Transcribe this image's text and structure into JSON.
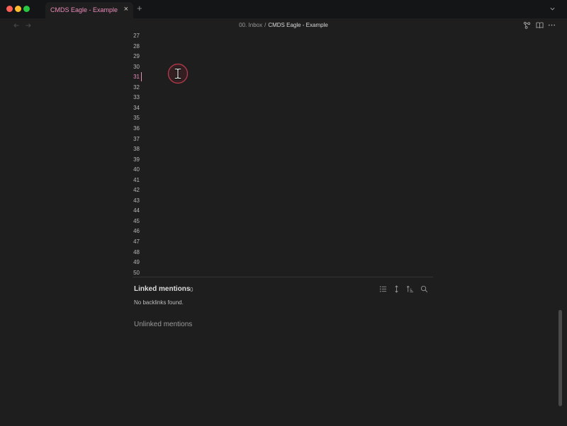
{
  "tab": {
    "title": "CMDS Eagle - Example",
    "close_glyph": "×",
    "new_tab_glyph": "+"
  },
  "breadcrumb": {
    "folder": "00. Inbox",
    "separator": "/",
    "current": "CMDS Eagle - Example"
  },
  "editor": {
    "line_numbers": [
      "27",
      "28",
      "29",
      "30",
      "31",
      "32",
      "33",
      "34",
      "35",
      "36",
      "37",
      "38",
      "39",
      "40",
      "41",
      "42",
      "43",
      "44",
      "45",
      "46",
      "47",
      "48",
      "49",
      "50"
    ],
    "active_line": "31"
  },
  "backlinks": {
    "linked_title": "Linked mentions",
    "linked_count": "0",
    "empty_message": "No backlinks found.",
    "unlinked_title": "Unlinked mentions"
  },
  "icons": {
    "window": [
      "close-window",
      "minimize-window",
      "zoom-window"
    ],
    "header": [
      "graph-icon",
      "reading-view-icon",
      "more-options-icon"
    ],
    "backlinks": [
      "list-icon",
      "collapse-icon",
      "sort-icon",
      "search-icon"
    ]
  },
  "colors": {
    "accent": "#e88bb8",
    "background": "#1e1e1e",
    "titlebar": "#131517"
  }
}
